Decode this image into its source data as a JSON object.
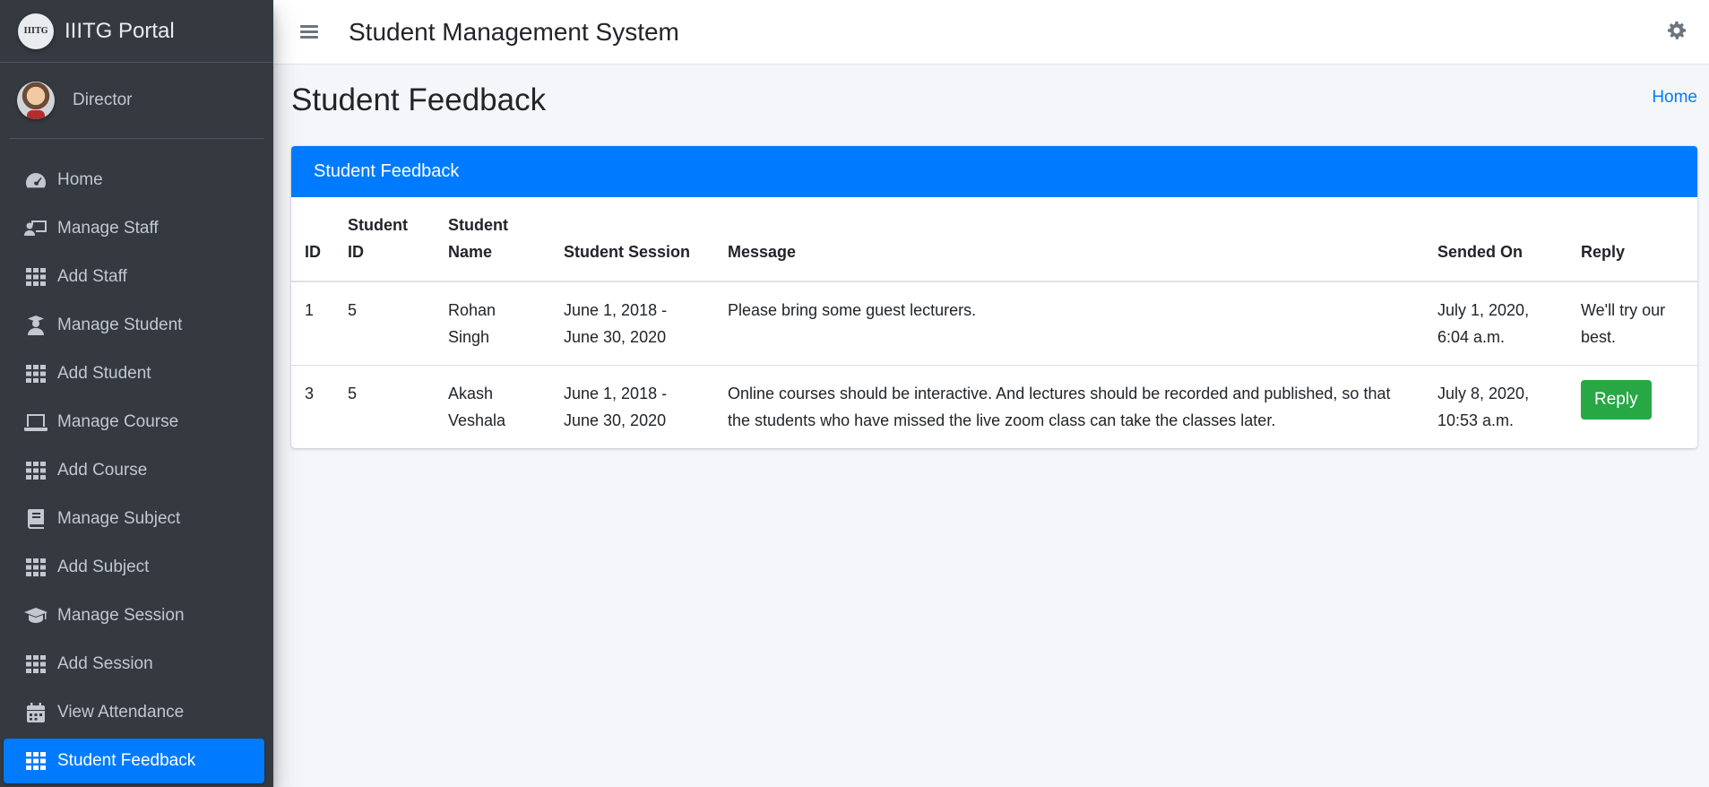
{
  "brand": {
    "logo_text": "IIITG",
    "name": "IIITG Portal"
  },
  "user": {
    "name": "Director"
  },
  "sidebar": {
    "items": [
      {
        "label": "Home",
        "icon": "tachometer-icon"
      },
      {
        "label": "Manage Staff",
        "icon": "chalkboard-teacher-icon"
      },
      {
        "label": "Add Staff",
        "icon": "th-grid-icon"
      },
      {
        "label": "Manage Student",
        "icon": "user-graduate-icon"
      },
      {
        "label": "Add Student",
        "icon": "th-grid-icon"
      },
      {
        "label": "Manage Course",
        "icon": "laptop-icon"
      },
      {
        "label": "Add Course",
        "icon": "th-grid-icon"
      },
      {
        "label": "Manage Subject",
        "icon": "book-icon"
      },
      {
        "label": "Add Subject",
        "icon": "th-grid-icon"
      },
      {
        "label": "Manage Session",
        "icon": "graduation-cap-icon"
      },
      {
        "label": "Add Session",
        "icon": "th-grid-icon"
      },
      {
        "label": "View Attendance",
        "icon": "calendar-icon"
      },
      {
        "label": "Student Feedback",
        "icon": "th-grid-icon",
        "active": true
      }
    ]
  },
  "header": {
    "title": "Student Management System"
  },
  "page": {
    "title": "Student Feedback",
    "breadcrumb": "Home"
  },
  "card": {
    "title": "Student Feedback",
    "columns": [
      "ID",
      "Student ID",
      "Student Name",
      "Student Session",
      "Message",
      "Sended On",
      "Reply"
    ],
    "rows": [
      {
        "id": "1",
        "student_id": "5",
        "student_name": "Rohan Singh",
        "session": "June 1, 2018 - June 30, 2020",
        "message": "Please bring some guest lecturers.",
        "sended_on": "July 1, 2020, 6:04 a.m.",
        "reply": "We'll try our best."
      },
      {
        "id": "3",
        "student_id": "5",
        "student_name": "Akash Veshala",
        "session": "June 1, 2018 - June 30, 2020",
        "message": "Online courses should be interactive. And lectures should be recorded and published, so that the students who have missed the live zoom class can take the classes later.",
        "sended_on": "July 8, 2020, 10:53 a.m.",
        "reply_button": "Reply"
      }
    ]
  },
  "colors": {
    "primary": "#007bff",
    "sidebar_bg": "#343a40",
    "success": "#28a745",
    "content_bg": "#f4f6f9"
  }
}
